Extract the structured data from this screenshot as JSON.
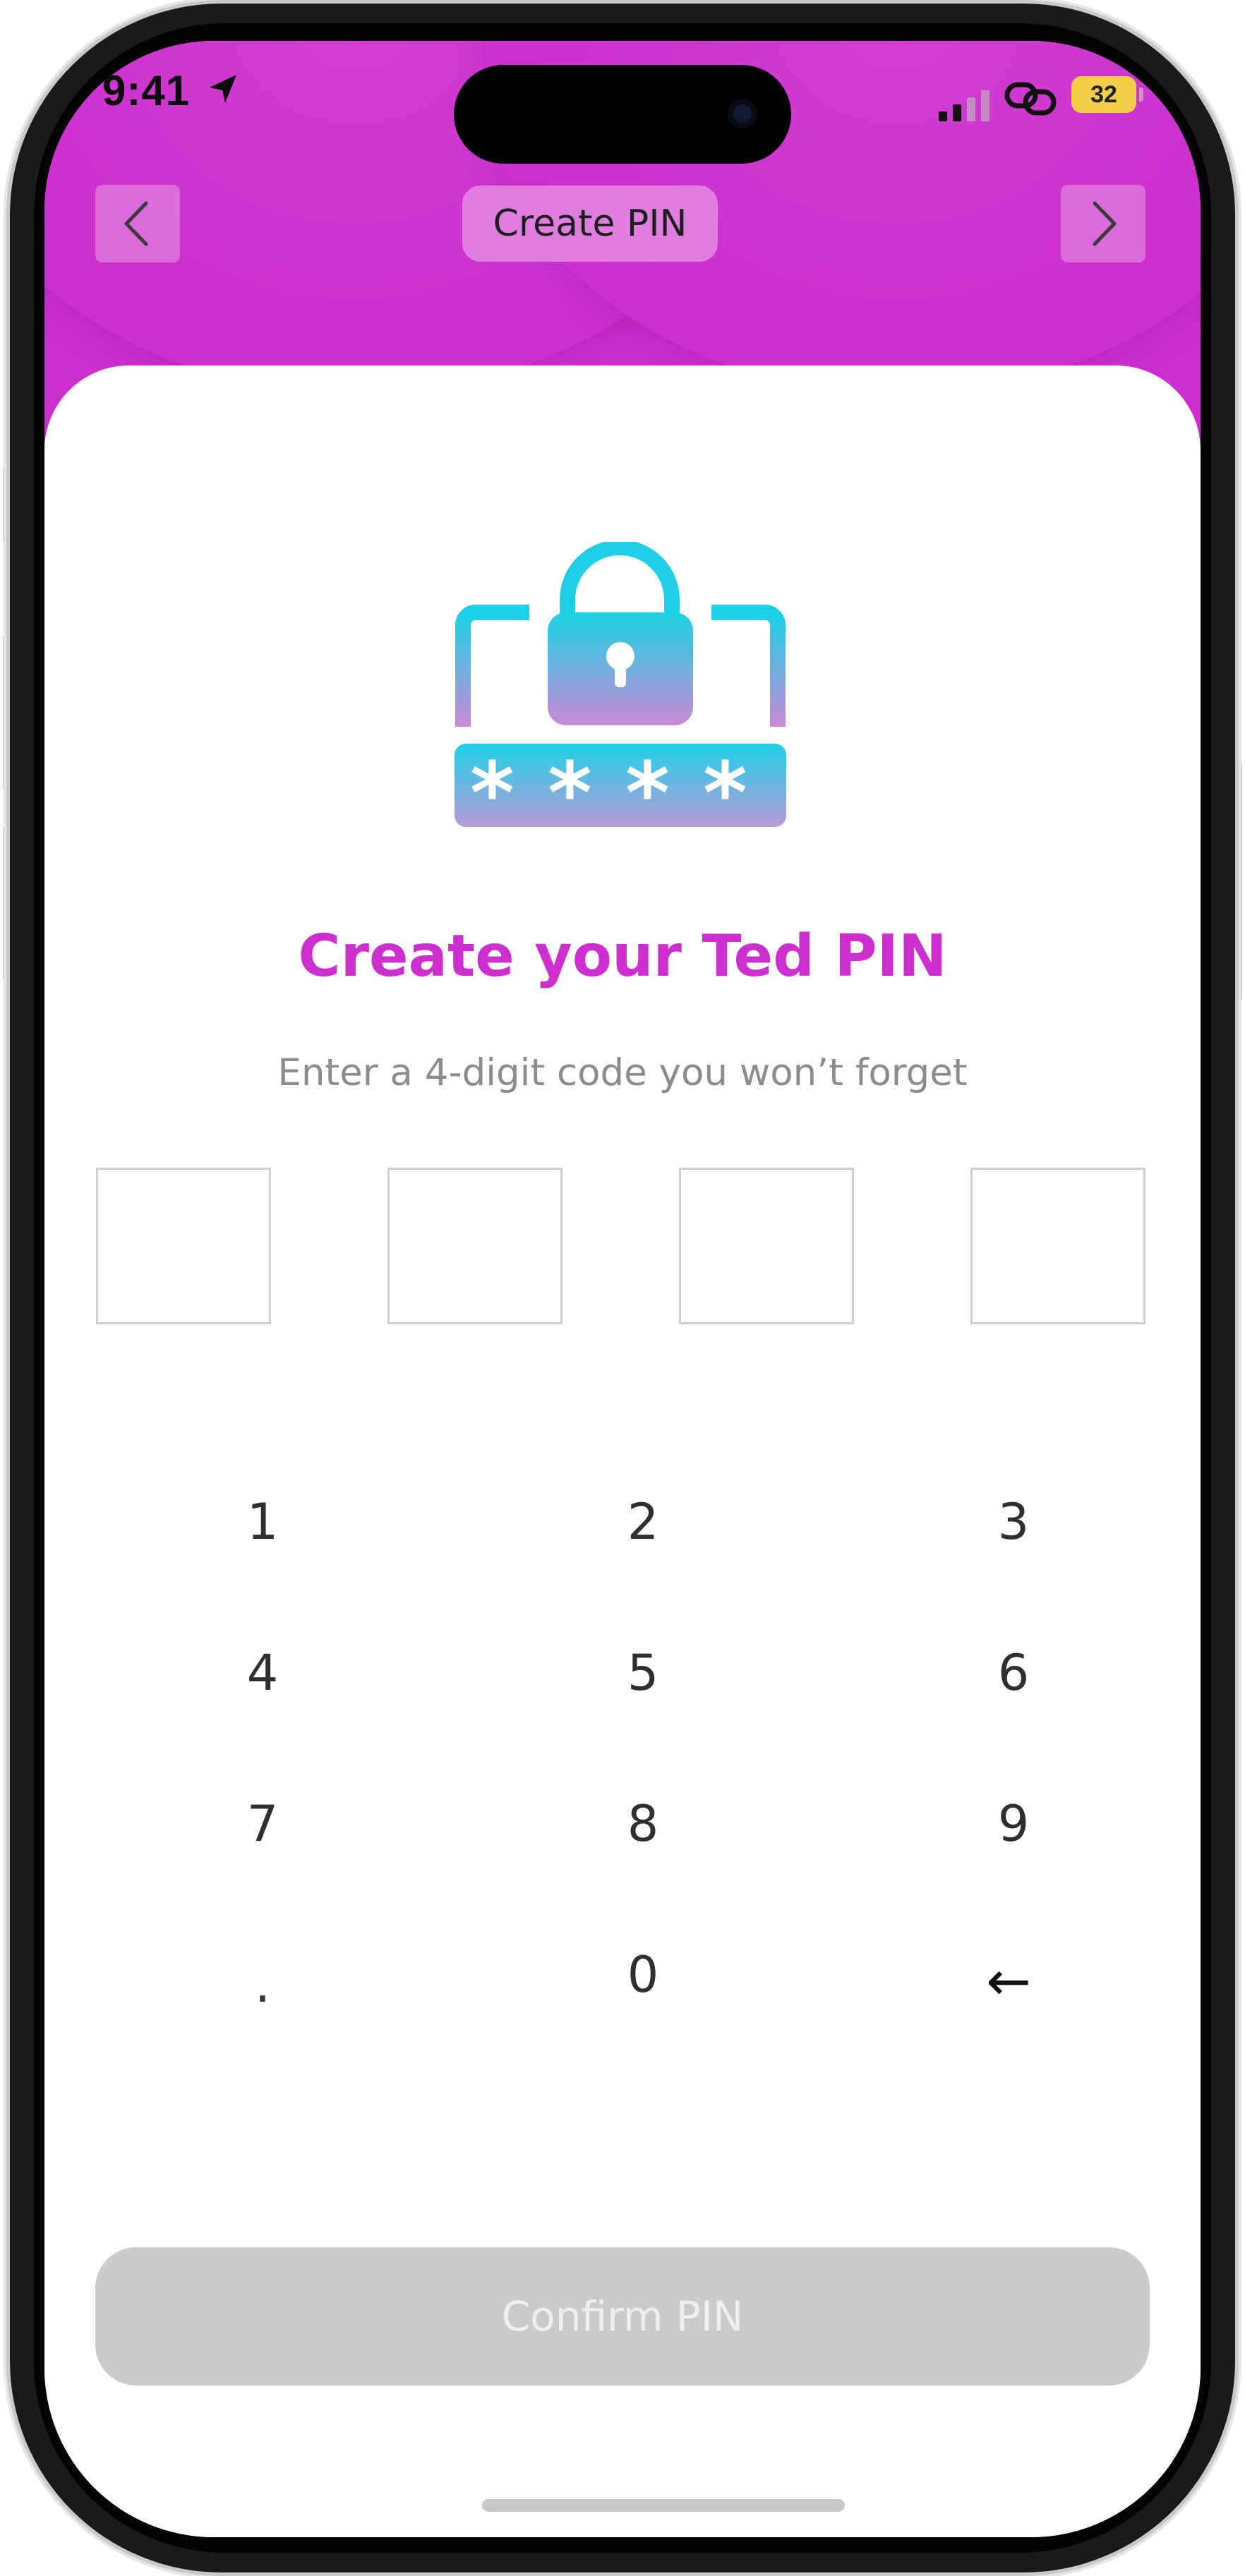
{
  "status": {
    "time": "9:41",
    "battery": "32"
  },
  "header": {
    "title": "Create PIN"
  },
  "main": {
    "heading": "Create your Ted PIN",
    "subheading": "Enter a 4-digit code you won’t forget"
  },
  "keypad": {
    "k1": "1",
    "k2": "2",
    "k3": "3",
    "k4": "4",
    "k5": "5",
    "k6": "6",
    "k7": "7",
    "k8": "8",
    "k9": "9",
    "kdot": ".",
    "k0": "0",
    "kback": "←"
  },
  "confirm_label": "Confirm PIN",
  "colors": {
    "brand": "#cc2fcd",
    "disabled_button": "#cbcbcb"
  },
  "icons": [
    "location-arrow-icon",
    "cellular-signal-icon",
    "link-icon",
    "chevron-left-icon",
    "chevron-right-icon",
    "padlock-pin-icon"
  ]
}
